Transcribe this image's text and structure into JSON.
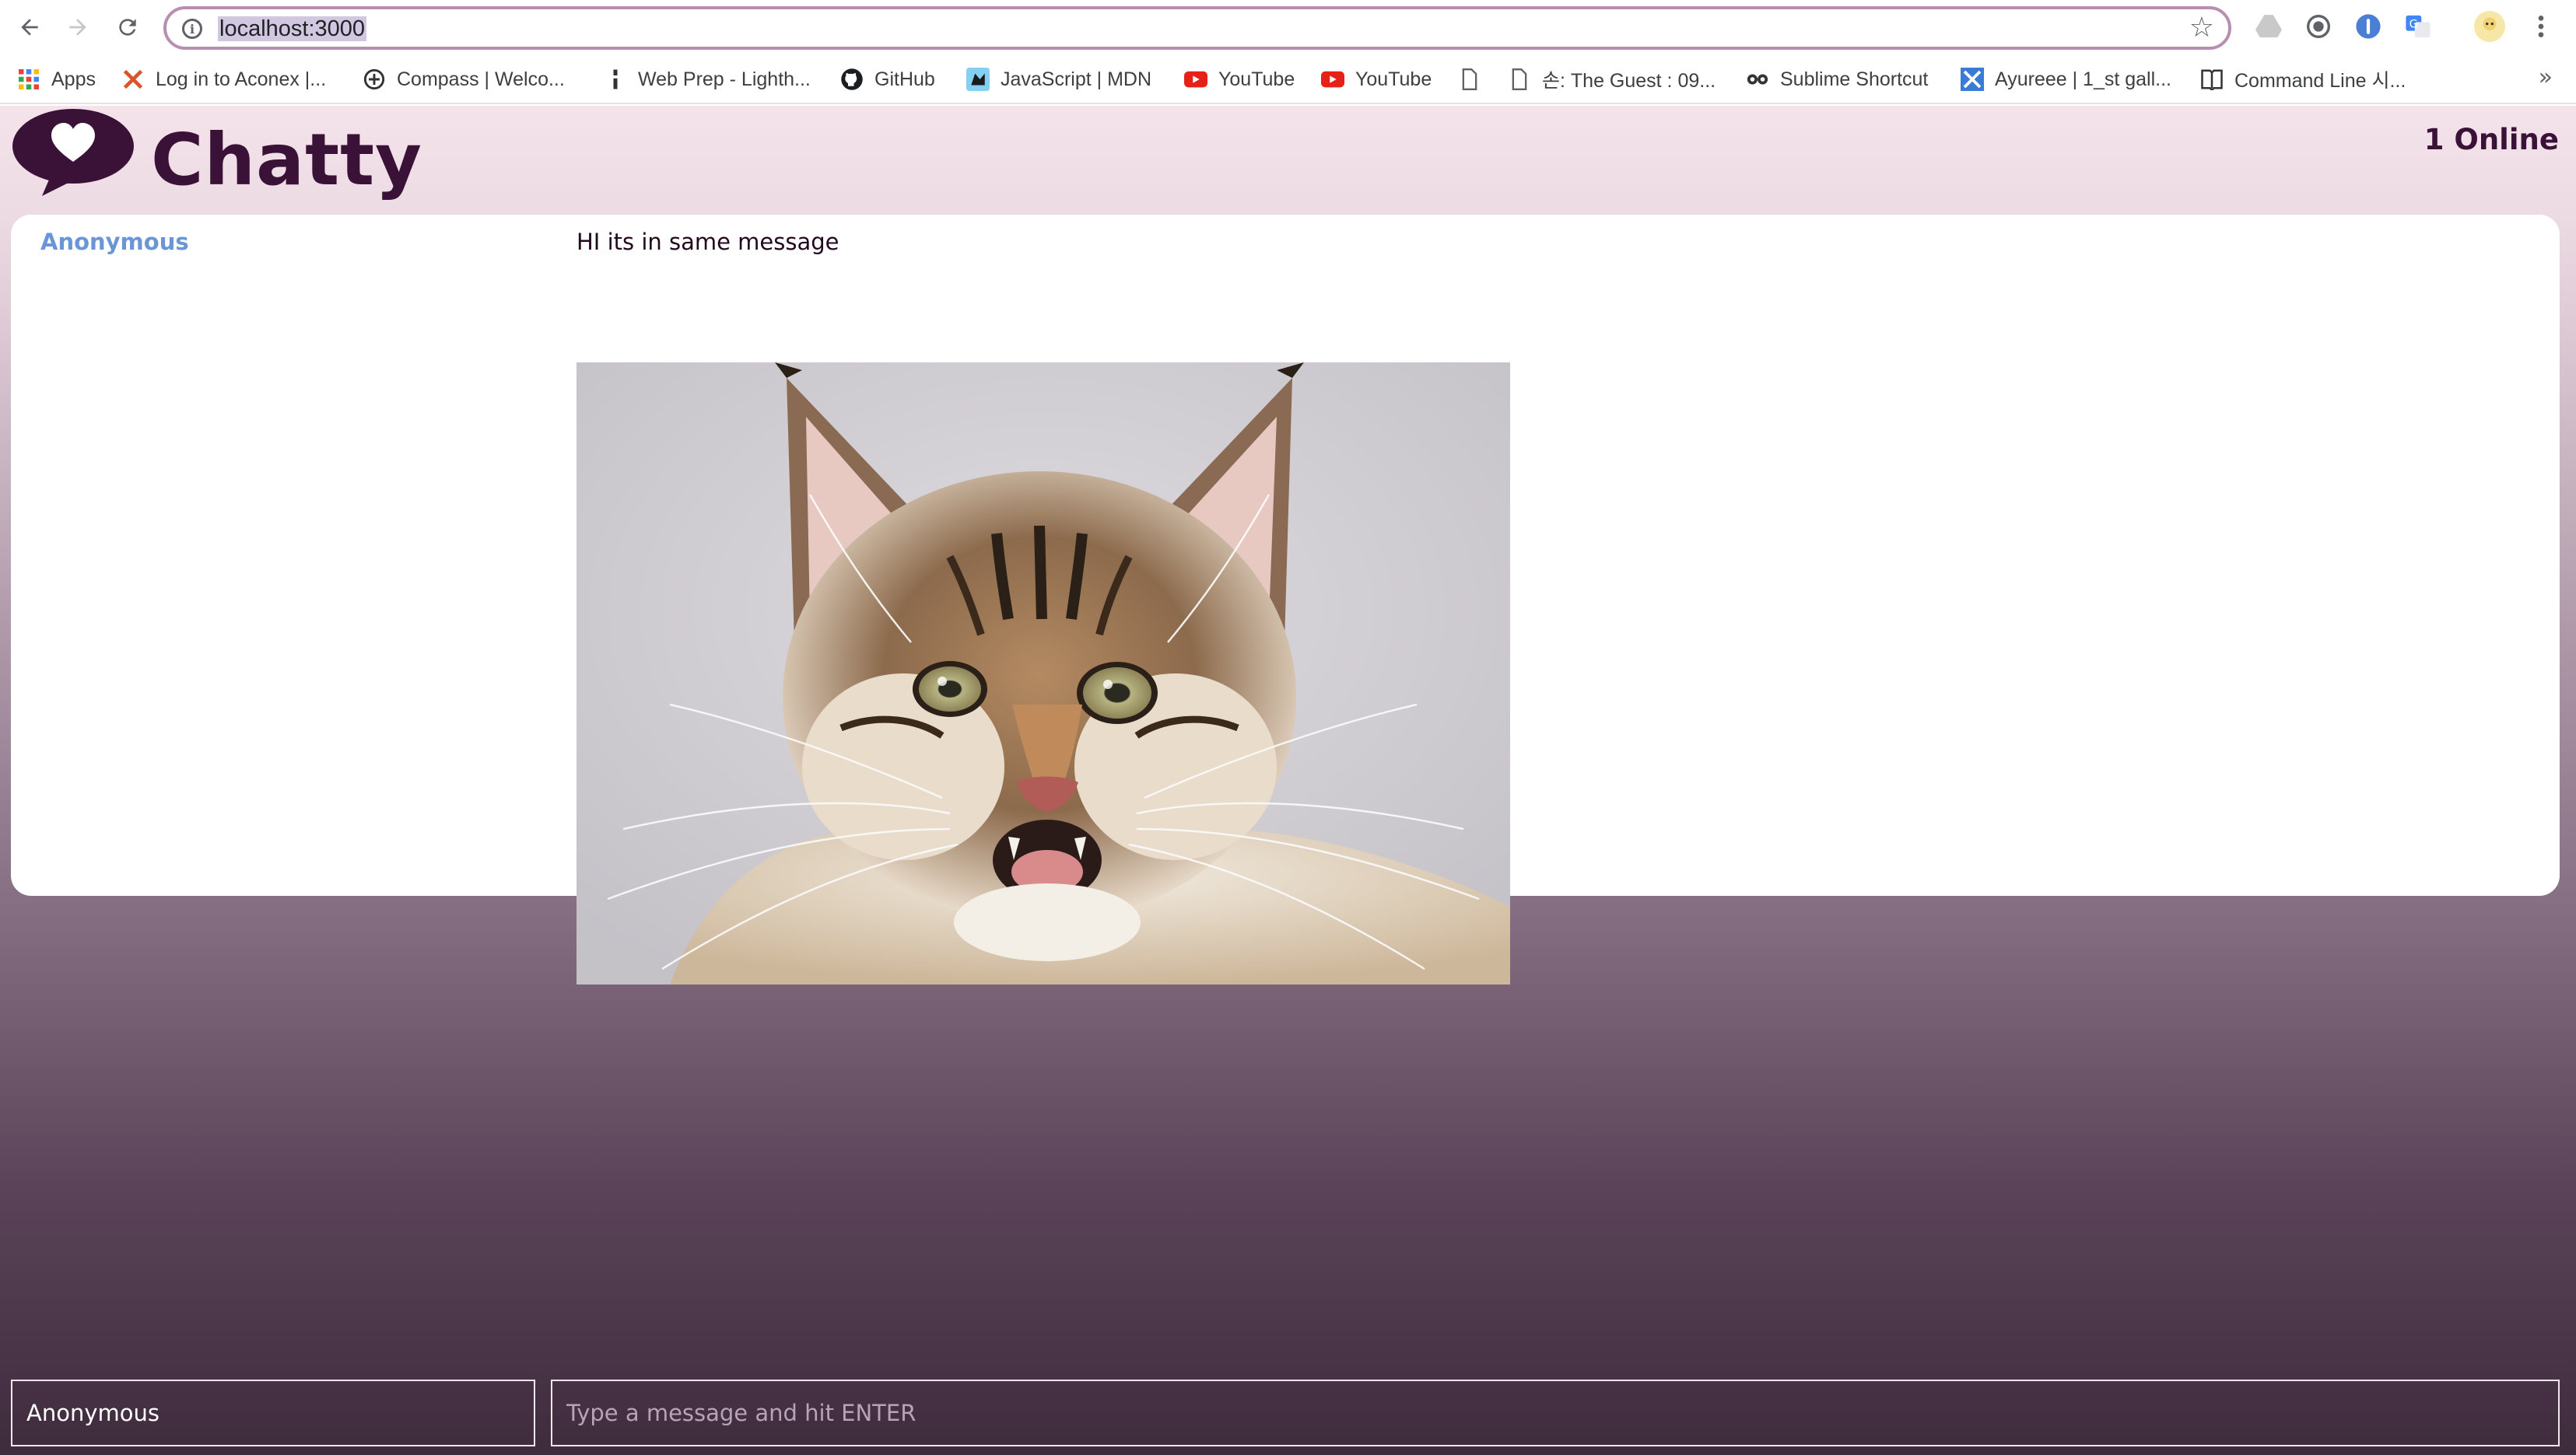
{
  "browser": {
    "url": "localhost:3000",
    "bookmarks": [
      {
        "label": "Apps",
        "icon": "apps-grid-icon"
      },
      {
        "label": "Log in to Aconex |...",
        "icon": "aconex-icon"
      },
      {
        "label": "Compass | Welco...",
        "icon": "compass-icon"
      },
      {
        "label": "Web Prep - Lighth...",
        "icon": "lighthouse-icon"
      },
      {
        "label": "GitHub",
        "icon": "github-icon"
      },
      {
        "label": "JavaScript | MDN",
        "icon": "mdn-icon"
      },
      {
        "label": "YouTube",
        "icon": "youtube-icon"
      },
      {
        "label": "YouTube",
        "icon": "youtube-icon"
      },
      {
        "label": "",
        "icon": "page-icon"
      },
      {
        "label": "손: The Guest : 09...",
        "icon": "page-icon"
      },
      {
        "label": "Sublime Shortcut",
        "icon": "glasses-icon"
      },
      {
        "label": "Ayureee | 1_st gall...",
        "icon": "ayureee-icon"
      },
      {
        "label": "Command Line 시...",
        "icon": "book-icon"
      }
    ],
    "more_label": "»"
  },
  "app": {
    "brand": "Chatty",
    "online_count": "1 Online",
    "colors": {
      "brand": "#3a1237",
      "username": "#6a95d6",
      "omnibox_border": "#b88fb0"
    }
  },
  "messages": [
    {
      "username": "Anonymous",
      "content": "HI its in same message",
      "image": "cat-photo"
    }
  ],
  "composer": {
    "username_value": "Anonymous",
    "message_placeholder": "Type a message and hit ENTER"
  }
}
